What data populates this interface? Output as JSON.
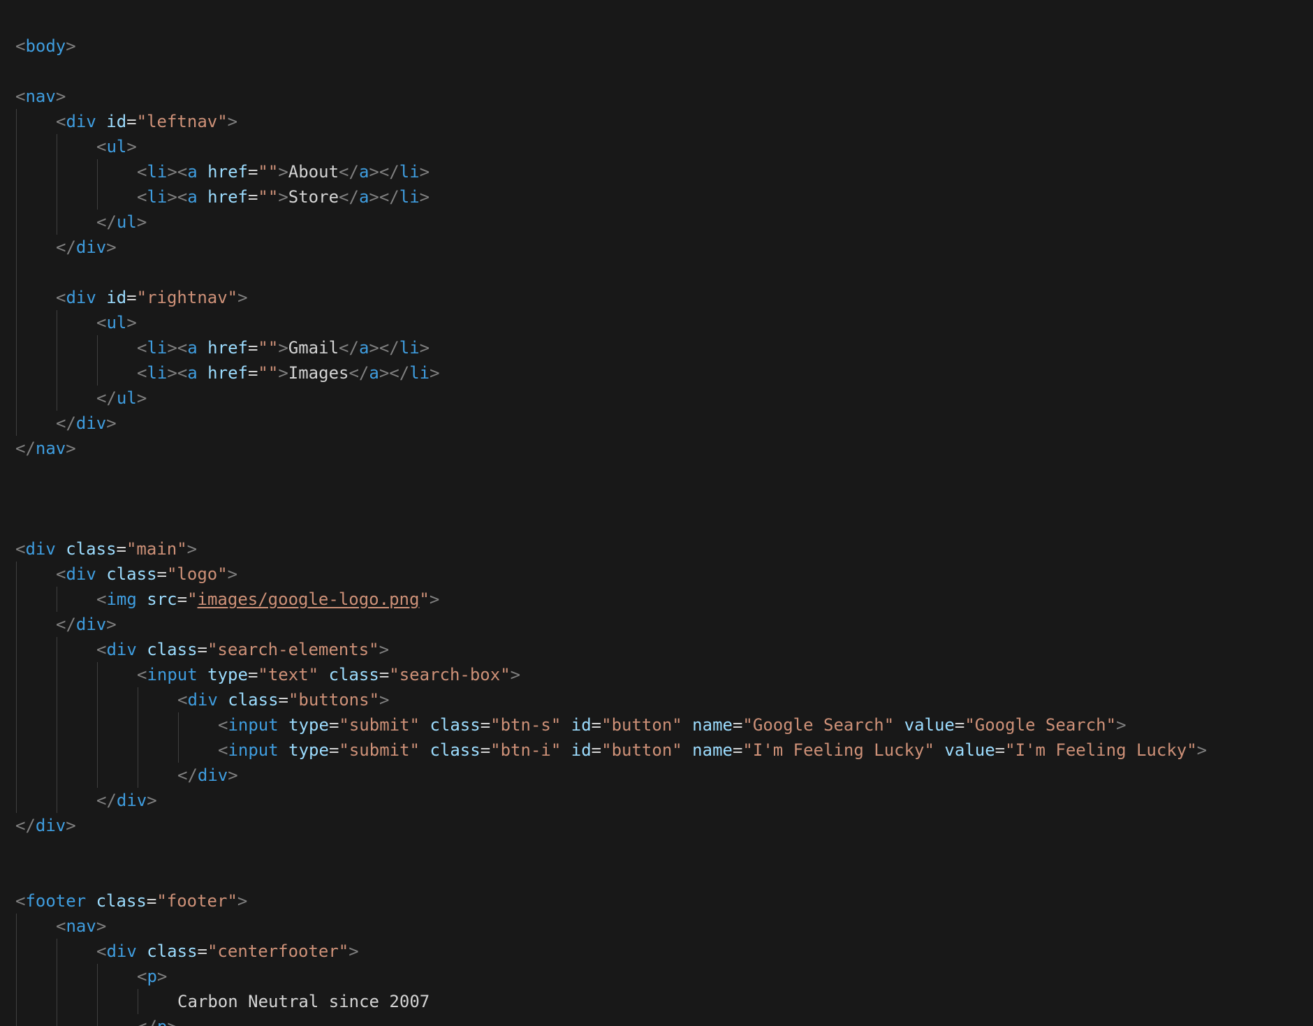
{
  "editor": {
    "lines": [
      {
        "indent": 0,
        "tokens": [
          [
            "b",
            "<"
          ],
          [
            "t",
            "body"
          ],
          [
            "b",
            ">"
          ]
        ]
      },
      {
        "indent": 0,
        "tokens": []
      },
      {
        "indent": 0,
        "tokens": [
          [
            "b",
            "<"
          ],
          [
            "t",
            "nav"
          ],
          [
            "b",
            ">"
          ]
        ]
      },
      {
        "indent": 1,
        "tokens": [
          [
            "b",
            "<"
          ],
          [
            "t",
            "div"
          ],
          [
            "s",
            " "
          ],
          [
            "a",
            "id"
          ],
          [
            "e",
            "="
          ],
          [
            "v",
            "\"leftnav\""
          ],
          [
            "b",
            ">"
          ]
        ]
      },
      {
        "indent": 2,
        "tokens": [
          [
            "b",
            "<"
          ],
          [
            "t",
            "ul"
          ],
          [
            "b",
            ">"
          ]
        ]
      },
      {
        "indent": 3,
        "tokens": [
          [
            "b",
            "<"
          ],
          [
            "t",
            "li"
          ],
          [
            "b",
            "><"
          ],
          [
            "t",
            "a"
          ],
          [
            "s",
            " "
          ],
          [
            "a",
            "href"
          ],
          [
            "e",
            "="
          ],
          [
            "v",
            "\"\""
          ],
          [
            "b",
            ">"
          ],
          [
            "x",
            "About"
          ],
          [
            "b",
            "</"
          ],
          [
            "t",
            "a"
          ],
          [
            "b",
            "></"
          ],
          [
            "t",
            "li"
          ],
          [
            "b",
            ">"
          ]
        ]
      },
      {
        "indent": 3,
        "tokens": [
          [
            "b",
            "<"
          ],
          [
            "t",
            "li"
          ],
          [
            "b",
            "><"
          ],
          [
            "t",
            "a"
          ],
          [
            "s",
            " "
          ],
          [
            "a",
            "href"
          ],
          [
            "e",
            "="
          ],
          [
            "v",
            "\"\""
          ],
          [
            "b",
            ">"
          ],
          [
            "x",
            "Store"
          ],
          [
            "b",
            "</"
          ],
          [
            "t",
            "a"
          ],
          [
            "b",
            "></"
          ],
          [
            "t",
            "li"
          ],
          [
            "b",
            ">"
          ]
        ]
      },
      {
        "indent": 2,
        "tokens": [
          [
            "b",
            "</"
          ],
          [
            "t",
            "ul"
          ],
          [
            "b",
            ">"
          ]
        ]
      },
      {
        "indent": 1,
        "tokens": [
          [
            "b",
            "</"
          ],
          [
            "t",
            "div"
          ],
          [
            "b",
            ">"
          ]
        ]
      },
      {
        "indent": 0,
        "tokens": []
      },
      {
        "indent": 1,
        "tokens": [
          [
            "b",
            "<"
          ],
          [
            "t",
            "div"
          ],
          [
            "s",
            " "
          ],
          [
            "a",
            "id"
          ],
          [
            "e",
            "="
          ],
          [
            "v",
            "\"rightnav\""
          ],
          [
            "b",
            ">"
          ]
        ]
      },
      {
        "indent": 2,
        "tokens": [
          [
            "b",
            "<"
          ],
          [
            "t",
            "ul"
          ],
          [
            "b",
            ">"
          ]
        ]
      },
      {
        "indent": 3,
        "tokens": [
          [
            "b",
            "<"
          ],
          [
            "t",
            "li"
          ],
          [
            "b",
            "><"
          ],
          [
            "t",
            "a"
          ],
          [
            "s",
            " "
          ],
          [
            "a",
            "href"
          ],
          [
            "e",
            "="
          ],
          [
            "v",
            "\"\""
          ],
          [
            "b",
            ">"
          ],
          [
            "x",
            "Gmail"
          ],
          [
            "b",
            "</"
          ],
          [
            "t",
            "a"
          ],
          [
            "b",
            "></"
          ],
          [
            "t",
            "li"
          ],
          [
            "b",
            ">"
          ]
        ]
      },
      {
        "indent": 3,
        "tokens": [
          [
            "b",
            "<"
          ],
          [
            "t",
            "li"
          ],
          [
            "b",
            "><"
          ],
          [
            "t",
            "a"
          ],
          [
            "s",
            " "
          ],
          [
            "a",
            "href"
          ],
          [
            "e",
            "="
          ],
          [
            "v",
            "\"\""
          ],
          [
            "b",
            ">"
          ],
          [
            "x",
            "Images"
          ],
          [
            "b",
            "</"
          ],
          [
            "t",
            "a"
          ],
          [
            "b",
            "></"
          ],
          [
            "t",
            "li"
          ],
          [
            "b",
            ">"
          ]
        ]
      },
      {
        "indent": 2,
        "tokens": [
          [
            "b",
            "</"
          ],
          [
            "t",
            "ul"
          ],
          [
            "b",
            ">"
          ]
        ]
      },
      {
        "indent": 1,
        "tokens": [
          [
            "b",
            "</"
          ],
          [
            "t",
            "div"
          ],
          [
            "b",
            ">"
          ]
        ]
      },
      {
        "indent": 0,
        "tokens": [
          [
            "b",
            "</"
          ],
          [
            "t",
            "nav"
          ],
          [
            "b",
            ">"
          ]
        ]
      },
      {
        "indent": 0,
        "tokens": []
      },
      {
        "indent": 0,
        "tokens": []
      },
      {
        "indent": 0,
        "tokens": []
      },
      {
        "indent": 0,
        "tokens": [
          [
            "b",
            "<"
          ],
          [
            "t",
            "div"
          ],
          [
            "s",
            " "
          ],
          [
            "a",
            "class"
          ],
          [
            "e",
            "="
          ],
          [
            "v",
            "\"main\""
          ],
          [
            "b",
            ">"
          ]
        ]
      },
      {
        "indent": 1,
        "tokens": [
          [
            "b",
            "<"
          ],
          [
            "t",
            "div"
          ],
          [
            "s",
            " "
          ],
          [
            "a",
            "class"
          ],
          [
            "e",
            "="
          ],
          [
            "v",
            "\"logo\""
          ],
          [
            "b",
            ">"
          ]
        ]
      },
      {
        "indent": 2,
        "tokens": [
          [
            "b",
            "<"
          ],
          [
            "t",
            "img"
          ],
          [
            "s",
            " "
          ],
          [
            "a",
            "src"
          ],
          [
            "e",
            "="
          ],
          [
            "v",
            "\""
          ],
          [
            "u",
            "images/google-logo.png"
          ],
          [
            "v",
            "\""
          ],
          [
            "b",
            ">"
          ]
        ]
      },
      {
        "indent": 1,
        "tokens": [
          [
            "b",
            "</"
          ],
          [
            "t",
            "div"
          ],
          [
            "b",
            ">"
          ]
        ]
      },
      {
        "indent": 2,
        "tokens": [
          [
            "b",
            "<"
          ],
          [
            "t",
            "div"
          ],
          [
            "s",
            " "
          ],
          [
            "a",
            "class"
          ],
          [
            "e",
            "="
          ],
          [
            "v",
            "\"search-elements\""
          ],
          [
            "b",
            ">"
          ]
        ]
      },
      {
        "indent": 3,
        "tokens": [
          [
            "b",
            "<"
          ],
          [
            "t",
            "input"
          ],
          [
            "s",
            " "
          ],
          [
            "a",
            "type"
          ],
          [
            "e",
            "="
          ],
          [
            "v",
            "\"text\""
          ],
          [
            "s",
            " "
          ],
          [
            "a",
            "class"
          ],
          [
            "e",
            "="
          ],
          [
            "v",
            "\"search-box\""
          ],
          [
            "b",
            ">"
          ]
        ]
      },
      {
        "indent": 4,
        "tokens": [
          [
            "b",
            "<"
          ],
          [
            "t",
            "div"
          ],
          [
            "s",
            " "
          ],
          [
            "a",
            "class"
          ],
          [
            "e",
            "="
          ],
          [
            "v",
            "\"buttons\""
          ],
          [
            "b",
            ">"
          ]
        ]
      },
      {
        "indent": 5,
        "tokens": [
          [
            "b",
            "<"
          ],
          [
            "t",
            "input"
          ],
          [
            "s",
            " "
          ],
          [
            "a",
            "type"
          ],
          [
            "e",
            "="
          ],
          [
            "v",
            "\"submit\""
          ],
          [
            "s",
            " "
          ],
          [
            "a",
            "class"
          ],
          [
            "e",
            "="
          ],
          [
            "v",
            "\"btn-s\""
          ],
          [
            "s",
            " "
          ],
          [
            "a",
            "id"
          ],
          [
            "e",
            "="
          ],
          [
            "v",
            "\"button\""
          ],
          [
            "s",
            " "
          ],
          [
            "a",
            "name"
          ],
          [
            "e",
            "="
          ],
          [
            "v",
            "\"Google Search\""
          ],
          [
            "s",
            " "
          ],
          [
            "a",
            "value"
          ],
          [
            "e",
            "="
          ],
          [
            "v",
            "\"Google Search\""
          ],
          [
            "b",
            ">"
          ]
        ]
      },
      {
        "indent": 5,
        "tokens": [
          [
            "b",
            "<"
          ],
          [
            "t",
            "input"
          ],
          [
            "s",
            " "
          ],
          [
            "a",
            "type"
          ],
          [
            "e",
            "="
          ],
          [
            "v",
            "\"submit\""
          ],
          [
            "s",
            " "
          ],
          [
            "a",
            "class"
          ],
          [
            "e",
            "="
          ],
          [
            "v",
            "\"btn-i\""
          ],
          [
            "s",
            " "
          ],
          [
            "a",
            "id"
          ],
          [
            "e",
            "="
          ],
          [
            "v",
            "\"button\""
          ],
          [
            "s",
            " "
          ],
          [
            "a",
            "name"
          ],
          [
            "e",
            "="
          ],
          [
            "v",
            "\"I'm Feeling Lucky\""
          ],
          [
            "s",
            " "
          ],
          [
            "a",
            "value"
          ],
          [
            "e",
            "="
          ],
          [
            "v",
            "\"I'm Feeling Lucky\""
          ],
          [
            "b",
            ">"
          ]
        ]
      },
      {
        "indent": 4,
        "tokens": [
          [
            "b",
            "</"
          ],
          [
            "t",
            "div"
          ],
          [
            "b",
            ">"
          ]
        ]
      },
      {
        "indent": 2,
        "tokens": [
          [
            "b",
            "</"
          ],
          [
            "t",
            "div"
          ],
          [
            "b",
            ">"
          ]
        ]
      },
      {
        "indent": 0,
        "tokens": [
          [
            "b",
            "</"
          ],
          [
            "t",
            "div"
          ],
          [
            "b",
            ">"
          ]
        ]
      },
      {
        "indent": 0,
        "tokens": []
      },
      {
        "indent": 0,
        "tokens": []
      },
      {
        "indent": 0,
        "tokens": [
          [
            "b",
            "<"
          ],
          [
            "t",
            "footer"
          ],
          [
            "s",
            " "
          ],
          [
            "a",
            "class"
          ],
          [
            "e",
            "="
          ],
          [
            "v",
            "\"footer\""
          ],
          [
            "b",
            ">"
          ]
        ]
      },
      {
        "indent": 1,
        "tokens": [
          [
            "b",
            "<"
          ],
          [
            "t",
            "nav"
          ],
          [
            "b",
            ">"
          ]
        ]
      },
      {
        "indent": 2,
        "tokens": [
          [
            "b",
            "<"
          ],
          [
            "t",
            "div"
          ],
          [
            "s",
            " "
          ],
          [
            "a",
            "class"
          ],
          [
            "e",
            "="
          ],
          [
            "v",
            "\"centerfooter\""
          ],
          [
            "b",
            ">"
          ]
        ]
      },
      {
        "indent": 3,
        "tokens": [
          [
            "b",
            "<"
          ],
          [
            "t",
            "p"
          ],
          [
            "b",
            ">"
          ]
        ]
      },
      {
        "indent": 4,
        "tokens": [
          [
            "x",
            "Carbon Neutral since 2007"
          ]
        ]
      },
      {
        "indent": 3,
        "tokens": [
          [
            "b",
            "</"
          ],
          [
            "t",
            "p"
          ],
          [
            "b",
            ">"
          ]
        ]
      }
    ]
  },
  "colors": {
    "background": "#181818",
    "bracket": "#808080",
    "tag": "#3f9ddf",
    "attribute": "#9cdcfe",
    "string": "#ce9178",
    "text": "#d4d4d4",
    "guide": "#404040"
  }
}
